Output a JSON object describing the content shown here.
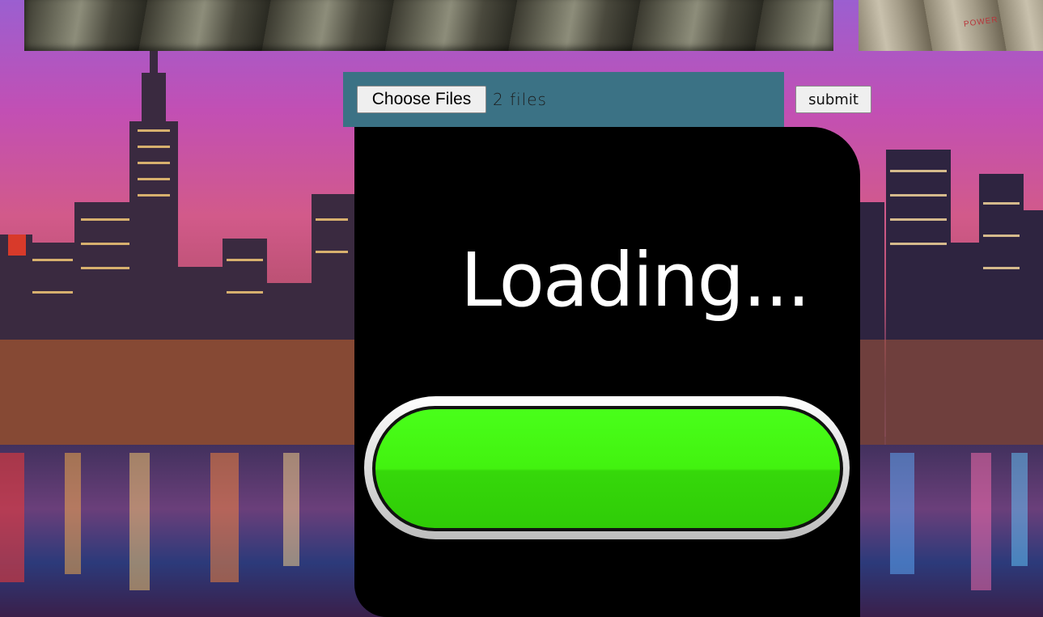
{
  "upload_form": {
    "choose_files_label": "Choose Files",
    "files_selected_text": "2  files",
    "submit_label": "submit"
  },
  "loading_panel": {
    "text": "Loading...",
    "progress_fraction": 1.0,
    "bar_color": "#43f410"
  },
  "background": {
    "top_strip_right_text": "POWER"
  },
  "colors": {
    "form_bar": "#3b7285",
    "panel": "#000000"
  }
}
